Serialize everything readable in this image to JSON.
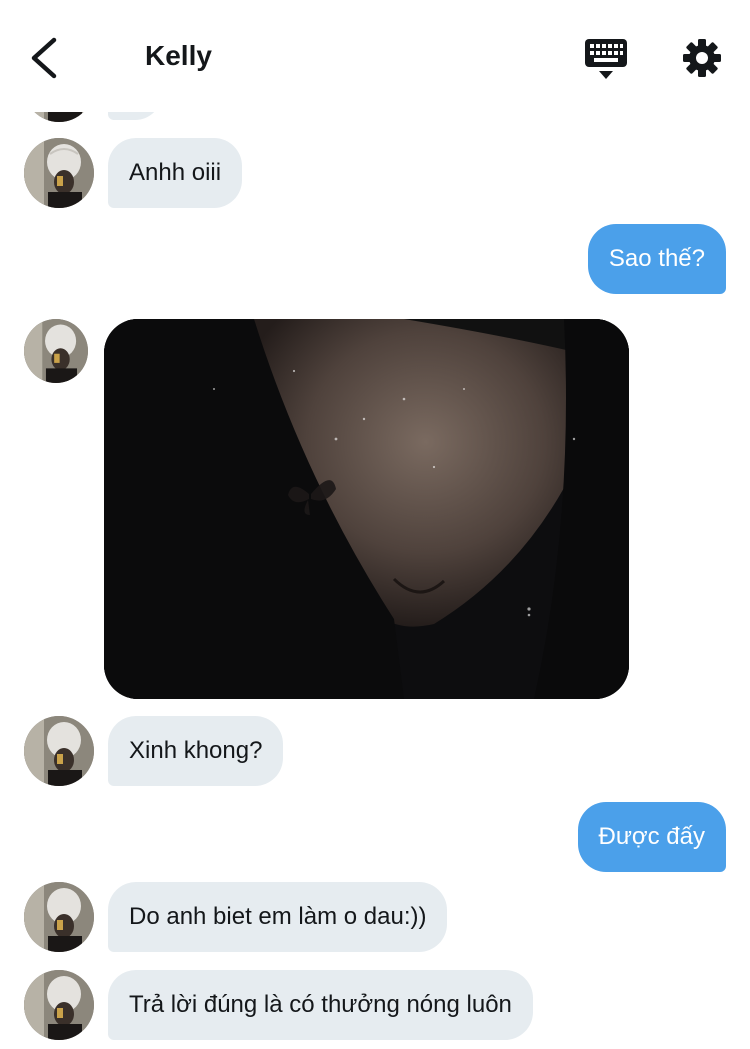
{
  "header": {
    "title": "Kelly",
    "back_icon": "chevron-left-icon",
    "keyboard_icon": "keyboard-icon",
    "settings_icon": "gear-icon"
  },
  "colors": {
    "incoming_bubble": "#e6ecf0",
    "outgoing_bubble": "#4ba0ea",
    "outgoing_text": "#ffffff",
    "incoming_text": "#14171a"
  },
  "messages": [
    {
      "direction": "incoming",
      "text": "Anhh oiii"
    },
    {
      "direction": "outgoing",
      "text": "Sao thế?"
    },
    {
      "direction": "incoming",
      "type": "image"
    },
    {
      "direction": "incoming",
      "text": "Xinh khong?"
    },
    {
      "direction": "outgoing",
      "text": "Được đấy"
    },
    {
      "direction": "incoming",
      "text": "Do anh biet em làm o dau:))"
    },
    {
      "direction": "incoming",
      "text": "Trả lời đúng là có thưởng nóng luôn"
    }
  ]
}
